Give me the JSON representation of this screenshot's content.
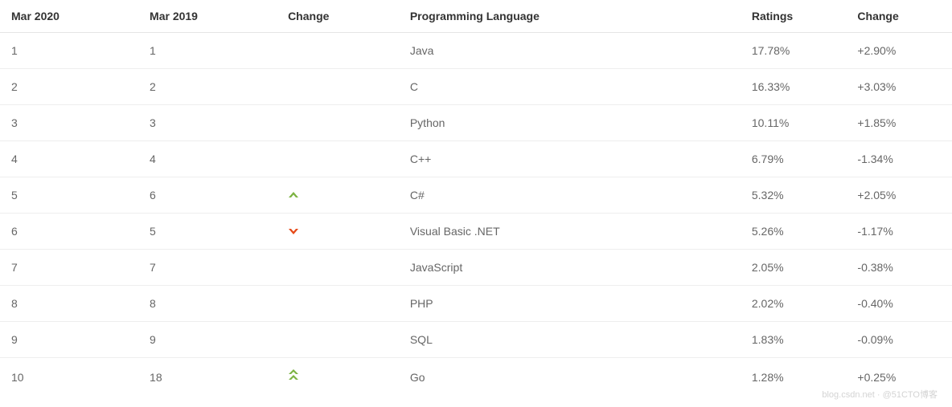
{
  "headers": {
    "mar2020": "Mar 2020",
    "mar2019": "Mar 2019",
    "change1": "Change",
    "language": "Programming Language",
    "ratings": "Ratings",
    "change2": "Change"
  },
  "rows": [
    {
      "mar2020": "1",
      "mar2019": "1",
      "trend": "",
      "language": "Java",
      "ratings": "17.78%",
      "change": "+2.90%"
    },
    {
      "mar2020": "2",
      "mar2019": "2",
      "trend": "",
      "language": "C",
      "ratings": "16.33%",
      "change": "+3.03%"
    },
    {
      "mar2020": "3",
      "mar2019": "3",
      "trend": "",
      "language": "Python",
      "ratings": "10.11%",
      "change": "+1.85%"
    },
    {
      "mar2020": "4",
      "mar2019": "4",
      "trend": "",
      "language": "C++",
      "ratings": "6.79%",
      "change": "-1.34%"
    },
    {
      "mar2020": "5",
      "mar2019": "6",
      "trend": "up",
      "language": "C#",
      "ratings": "5.32%",
      "change": "+2.05%"
    },
    {
      "mar2020": "6",
      "mar2019": "5",
      "trend": "down",
      "language": "Visual Basic .NET",
      "ratings": "5.26%",
      "change": "-1.17%"
    },
    {
      "mar2020": "7",
      "mar2019": "7",
      "trend": "",
      "language": "JavaScript",
      "ratings": "2.05%",
      "change": "-0.38%"
    },
    {
      "mar2020": "8",
      "mar2019": "8",
      "trend": "",
      "language": "PHP",
      "ratings": "2.02%",
      "change": "-0.40%"
    },
    {
      "mar2020": "9",
      "mar2019": "9",
      "trend": "",
      "language": "SQL",
      "ratings": "1.83%",
      "change": "-0.09%"
    },
    {
      "mar2020": "10",
      "mar2019": "18",
      "trend": "dblup",
      "language": "Go",
      "ratings": "1.28%",
      "change": "+0.25%"
    }
  ],
  "watermark": "blog.csdn.net · @51CTO博客"
}
